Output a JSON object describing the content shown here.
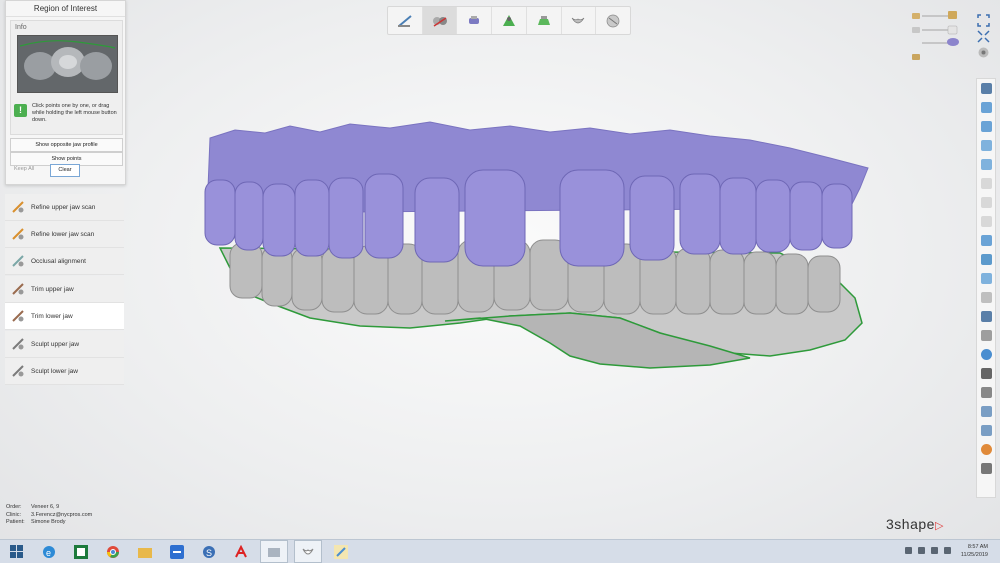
{
  "roi_panel": {
    "title": "Region of Interest",
    "info_label": "Info",
    "message": "Click points one by one, or drag while holding the left mouse button down.",
    "show_opposite_jaw_profile": "Show opposite jaw profile",
    "show_points": "Show points",
    "keep_all": "Keep All",
    "clear": "Clear"
  },
  "workflow_steps": [
    {
      "label": "Refine upper jaw scan",
      "icon": "refine-upper-icon",
      "active": false
    },
    {
      "label": "Refine lower jaw scan",
      "icon": "refine-lower-icon",
      "active": false
    },
    {
      "label": "Occlusal alignment",
      "icon": "occlusal-icon",
      "active": false
    },
    {
      "label": "Trim upper jaw",
      "icon": "trim-upper-icon",
      "active": false
    },
    {
      "label": "Trim lower jaw",
      "icon": "trim-lower-icon",
      "active": true
    },
    {
      "label": "Sculpt upper jaw",
      "icon": "sculpt-upper-icon",
      "active": false
    },
    {
      "label": "Sculpt lower jaw",
      "icon": "sculpt-lower-icon",
      "active": false
    }
  ],
  "top_toolbar": [
    "scan-prep-icon",
    "scan-edit-icon",
    "implant-icon",
    "design-icon",
    "model-icon",
    "crown-icon",
    "sphere-icon"
  ],
  "order_info": {
    "order_label": "Order:",
    "order_value": "Veneer 6, 9",
    "clinic_label": "Clinic:",
    "clinic_value": "3.Ferencz@nycpros.com",
    "patient_label": "Patient:",
    "patient_value": "Simone Brody"
  },
  "brand": {
    "name": "3shape",
    "mark": "▷"
  },
  "taskbar": {
    "time": "8:57 AM",
    "date": "11/25/2019",
    "apps": [
      "windows-start-icon",
      "internet-explorer-icon",
      "excel-icon",
      "chrome-icon",
      "file-explorer-icon",
      "teamviewer-icon",
      "skype-icon",
      "acrobat-icon",
      "3shape-icon",
      "dental-app-icon",
      "paint-icon"
    ]
  },
  "colors": {
    "upper_jaw": "#8c84cc",
    "lower_jaw": "#a9a9a9",
    "trim_line": "#2e9a3a",
    "accent": "#e04040"
  }
}
